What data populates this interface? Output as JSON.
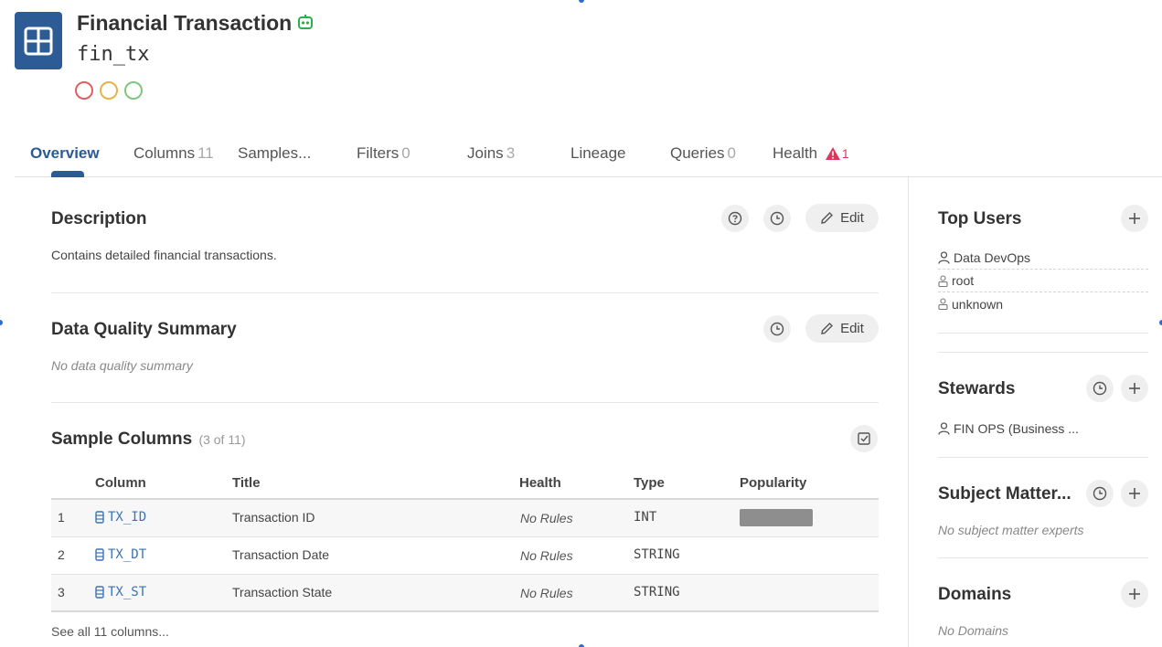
{
  "header": {
    "title": "Financial Transaction",
    "name": "fin_tx"
  },
  "tabs": [
    {
      "label": "Overview",
      "count": ""
    },
    {
      "label": "Columns",
      "count": "11"
    },
    {
      "label": "Samples...",
      "count": ""
    },
    {
      "label": "Filters",
      "count": "0"
    },
    {
      "label": "Joins",
      "count": "3"
    },
    {
      "label": "Lineage",
      "count": ""
    },
    {
      "label": "Queries",
      "count": "0"
    },
    {
      "label": "Health",
      "count": "1"
    }
  ],
  "description": {
    "title": "Description",
    "text": "Contains detailed financial transactions.",
    "edit_label": "Edit"
  },
  "dq_summary": {
    "title": "Data Quality Summary",
    "text": "No data quality summary",
    "edit_label": "Edit"
  },
  "sample_columns": {
    "title": "Sample Columns",
    "subtitle": "(3 of 11)",
    "headers": [
      "Column",
      "Title",
      "Health",
      "Type",
      "Popularity"
    ],
    "rows": [
      {
        "index": "1",
        "column": "TX_ID",
        "title": "Transaction ID",
        "health": "No Rules",
        "type": "INT",
        "popularity": 1.0
      },
      {
        "index": "2",
        "column": "TX_DT",
        "title": "Transaction Date",
        "health": "No Rules",
        "type": "STRING",
        "popularity": 0
      },
      {
        "index": "3",
        "column": "TX_ST",
        "title": "Transaction State",
        "health": "No Rules",
        "type": "STRING",
        "popularity": 0
      }
    ],
    "see_all": "See all 11 columns..."
  },
  "sidebar": {
    "top_users": {
      "title": "Top Users",
      "users": [
        "Data DevOps",
        "root",
        "unknown"
      ]
    },
    "stewards": {
      "title": "Stewards",
      "items": [
        "FIN OPS (Business ..."
      ]
    },
    "sme": {
      "title": "Subject Matter...",
      "empty": "No subject matter experts"
    },
    "domains": {
      "title": "Domains",
      "empty": "No Domains"
    }
  },
  "colors": {
    "accent": "#2d5b95",
    "link": "#3a73b8",
    "danger": "#e0365c",
    "ring_red": "#e06060",
    "ring_yellow": "#e8b24a",
    "ring_green": "#7ec77e"
  }
}
